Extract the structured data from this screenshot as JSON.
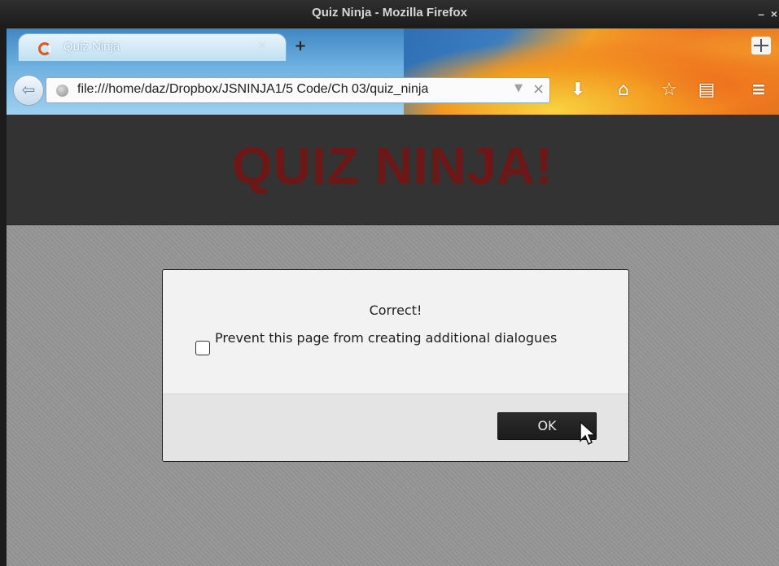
{
  "window": {
    "title": "Quiz Ninja - Mozilla Firefox",
    "minimize": "–",
    "close": "×"
  },
  "browser": {
    "tab": {
      "title": "Quiz Ninja",
      "close": "×"
    },
    "new_tab": "+",
    "url": "file:///home/daz/Dropbox/JSNINJA1/5 Code/Ch 03/quiz_ninja",
    "url_dropdown": "▼",
    "url_clear": "×",
    "icons": {
      "back": "arrow-left-icon",
      "download": "download-icon",
      "home": "home-icon",
      "bookmark": "star-icon",
      "reader": "reader-icon",
      "menu": "hamburger-menu-icon",
      "tab_groups": "tab-groups-icon"
    }
  },
  "page": {
    "heading": "QUIZ NINJA!",
    "heading_color": "#6d1717",
    "header_bg": "#333333",
    "body_bg": "#959595"
  },
  "dialog": {
    "message": "Correct!",
    "checkbox_label": "Prevent this page from creating additional dialogues",
    "checkbox_checked": false,
    "ok_label": "OK"
  }
}
